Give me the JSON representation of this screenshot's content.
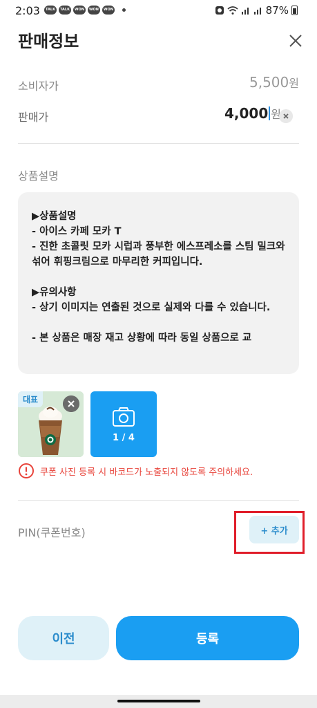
{
  "status_bar": {
    "time": "2:03",
    "notif_icons": [
      "TALK",
      "TALK",
      "WON",
      "WON",
      "WON"
    ],
    "battery": "87%"
  },
  "header": {
    "title": "판매정보"
  },
  "consumer_price": {
    "label": "소비자가",
    "value": "5,500",
    "unit": "원"
  },
  "sale_price": {
    "label": "판매가",
    "value": "4,000",
    "unit": "원"
  },
  "description": {
    "label": "상품설명",
    "text": "▶상품설명\n- 아이스 카페 모카 T\n- 진한 초콜릿 모카 시럽과 풍부한 에스프레소를 스팀 밀크와 섞어 휘핑크림으로 마무리한 커피입니다.\n\n▶유의사항\n- 상기 이미지는 연출된 것으로 실제와 다를 수 있습니다.\n\n- 본 상품은 매장 재고 상황에 따라 동일 상품으로 교"
  },
  "images": {
    "representative_badge": "대표",
    "count": "1 / 4"
  },
  "warning": {
    "text": "쿠폰 사진 등록 시 바코드가 노출되지 않도록 주의하세요."
  },
  "pin": {
    "label": "PIN(쿠폰번호)",
    "add_label": "+ 추가"
  },
  "buttons": {
    "prev": "이전",
    "submit": "등록"
  },
  "colors": {
    "accent": "#1a9ef2",
    "accent_light": "#dff1f8",
    "warning": "#e8433a",
    "highlight": "#e01e2a"
  }
}
